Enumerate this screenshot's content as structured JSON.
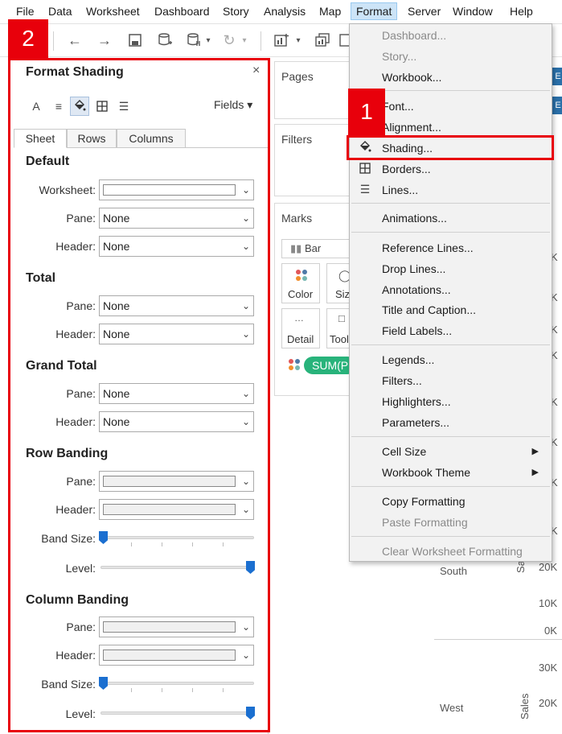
{
  "menubar": {
    "items": [
      "File",
      "Data",
      "Worksheet",
      "Dashboard",
      "Story",
      "Analysis",
      "Map",
      "Format",
      "Server",
      "Window",
      "Help"
    ],
    "active": "Format"
  },
  "toolbar": {
    "icons": [
      "back-icon",
      "forward-icon",
      "save-icon",
      "new-datasource-icon",
      "pause-updates-icon",
      "refresh-icon",
      "new-worksheet-icon",
      "duplicate-icon"
    ]
  },
  "shelves": {
    "pages": "Pages",
    "filters": "Filters",
    "marks": "Marks",
    "mark_type": "Bar",
    "color": "Color",
    "size": "Siz",
    "detail": "Detail",
    "tooltip": "Tool",
    "pill": "SUM(P"
  },
  "view": {
    "axis_ticks_top": [
      "K",
      "K",
      "K",
      "K",
      "K",
      "K",
      "K",
      "K"
    ],
    "row_south": "South",
    "row_west": "West",
    "sales": "Sales",
    "ticks": [
      "20K",
      "10K",
      "0K",
      "30K",
      "20K"
    ]
  },
  "panel": {
    "title": "Format Shading",
    "close": "×",
    "fields": "Fields ▾",
    "tabs": [
      "Sheet",
      "Rows",
      "Columns"
    ],
    "sections": {
      "default": "Default",
      "total": "Total",
      "grand_total": "Grand Total",
      "row_banding": "Row Banding",
      "column_banding": "Column Banding"
    },
    "labels": {
      "worksheet": "Worksheet:",
      "pane": "Pane:",
      "header": "Header:",
      "band_size": "Band Size:",
      "level": "Level:"
    },
    "none": "None",
    "row_band_size": 0,
    "row_level": 1,
    "col_band_size": 0,
    "col_level": 1
  },
  "format_menu": {
    "items": [
      {
        "label": "Dashboard...",
        "disabled": true
      },
      {
        "label": "Story...",
        "disabled": true
      },
      {
        "label": "Workbook...",
        "disabled": false
      },
      {
        "label": "Font...",
        "disabled": false
      },
      {
        "label": "Alignment...",
        "disabled": false
      },
      {
        "label": "Shading...",
        "disabled": false
      },
      {
        "label": "Borders...",
        "disabled": false
      },
      {
        "label": "Lines...",
        "disabled": false
      },
      {
        "label": "Animations...",
        "disabled": false
      },
      {
        "label": "Reference Lines...",
        "disabled": false
      },
      {
        "label": "Drop Lines...",
        "disabled": false
      },
      {
        "label": "Annotations...",
        "disabled": false
      },
      {
        "label": "Title and Caption...",
        "disabled": false
      },
      {
        "label": "Field Labels...",
        "disabled": false
      },
      {
        "label": "Legends...",
        "disabled": false
      },
      {
        "label": "Filters...",
        "disabled": false
      },
      {
        "label": "Highlighters...",
        "disabled": false
      },
      {
        "label": "Parameters...",
        "disabled": false
      },
      {
        "label": "Cell Size",
        "disabled": false
      },
      {
        "label": "Workbook Theme",
        "disabled": false
      },
      {
        "label": "Copy Formatting",
        "disabled": false
      },
      {
        "label": "Paste Formatting",
        "disabled": true
      },
      {
        "label": "Clear Worksheet Formatting",
        "disabled": true
      }
    ]
  },
  "callouts": {
    "one": "1",
    "two": "2"
  },
  "colors": {
    "callout": "#e8000b",
    "accent": "#1b6fd0",
    "pill": "#28b37b"
  }
}
